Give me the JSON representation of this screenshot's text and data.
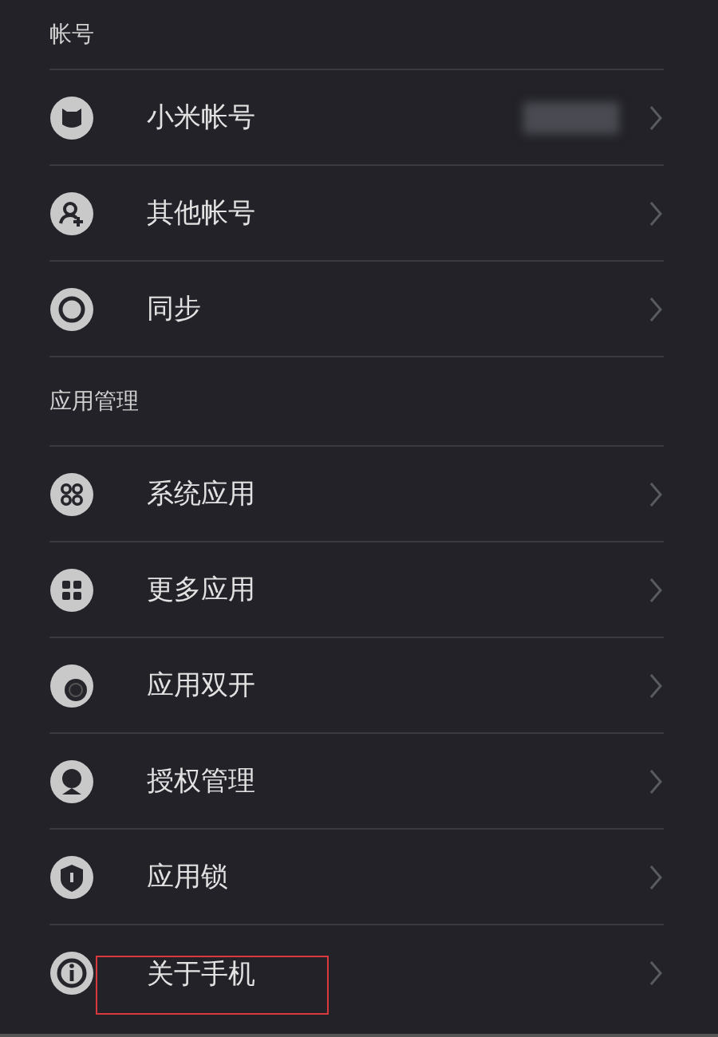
{
  "sections": [
    {
      "title": "帐号",
      "items": [
        {
          "kind": "bear",
          "label": "小米帐号",
          "blurred_value": true
        },
        {
          "kind": "person",
          "label": "其他帐号"
        },
        {
          "kind": "sync",
          "label": "同步"
        }
      ]
    },
    {
      "title": "应用管理",
      "items": [
        {
          "kind": "rings",
          "label": "系统应用"
        },
        {
          "kind": "squares",
          "label": "更多应用"
        },
        {
          "kind": "dual",
          "label": "应用双开"
        },
        {
          "kind": "badge",
          "label": "授权管理"
        },
        {
          "kind": "shield",
          "label": "应用锁"
        },
        {
          "kind": "info",
          "label": "关于手机",
          "highlighted": true
        }
      ]
    }
  ]
}
